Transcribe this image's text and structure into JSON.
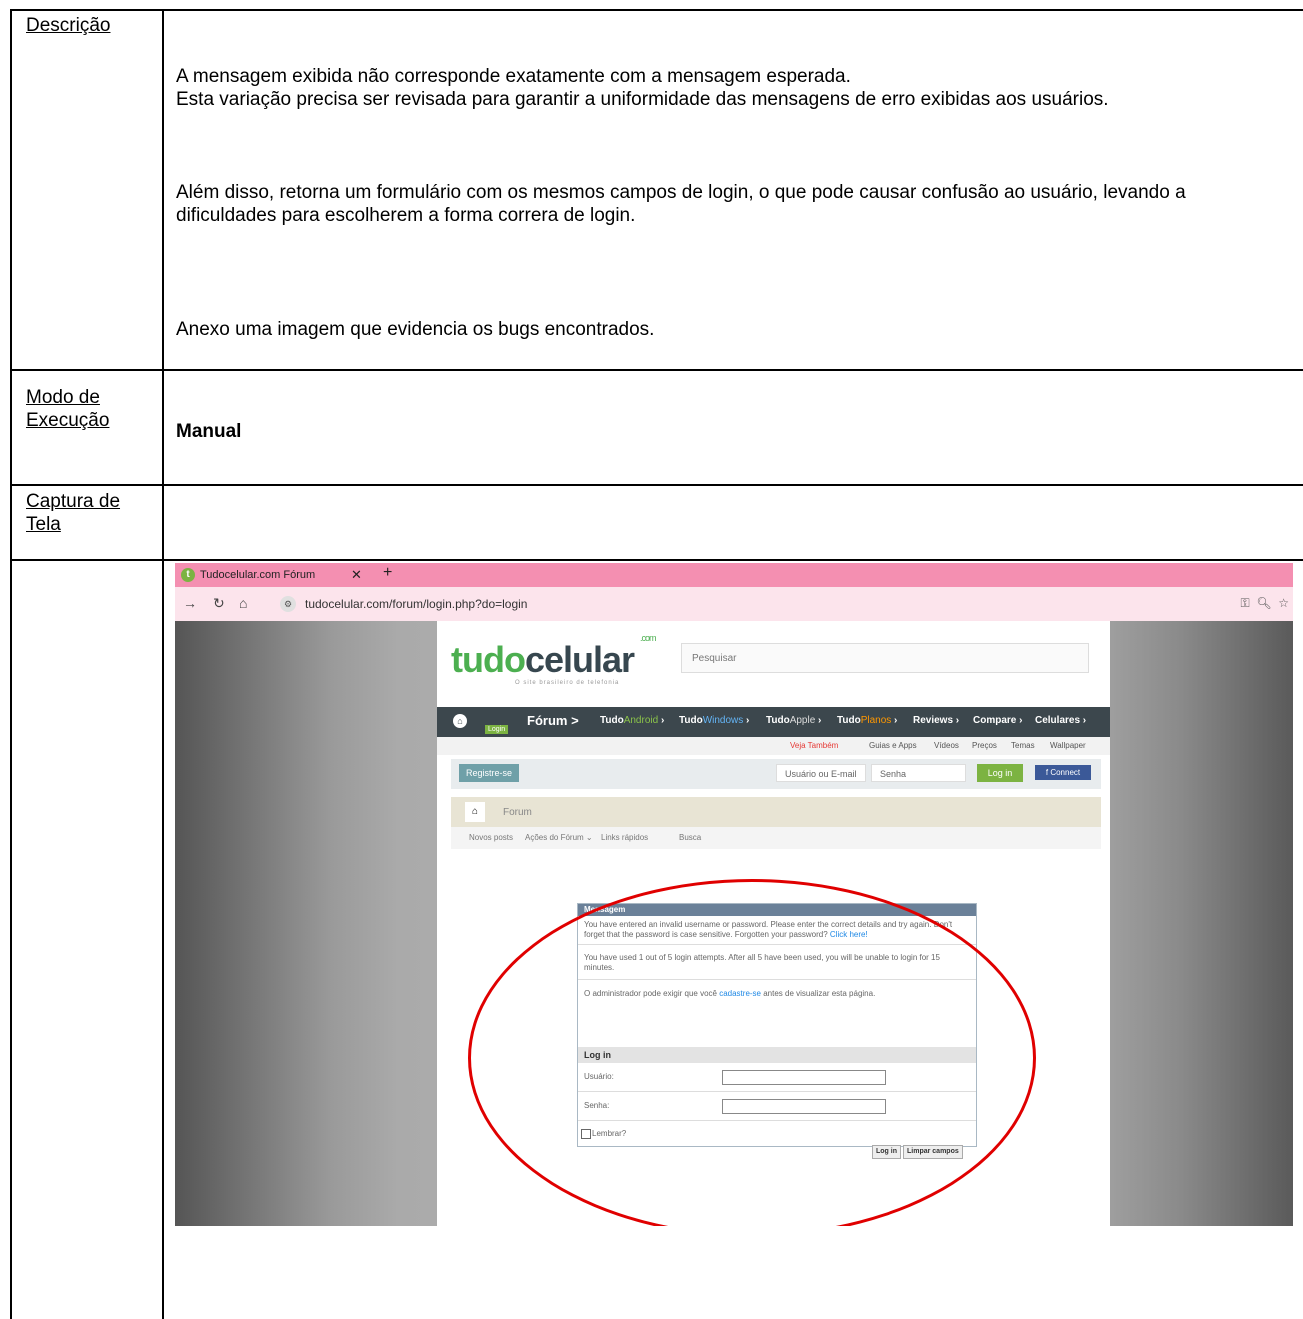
{
  "doc": {
    "rows": [
      {
        "label": "Descrição"
      },
      {
        "label_line1": "Modo de",
        "label_line2": "Execução",
        "value": "Manual"
      },
      {
        "label_line1": "Captura de",
        "label_line2": "Tela"
      }
    ],
    "description": [
      "A mensagem exibida não corresponde exatamente com a mensagem esperada.",
      "Esta variação precisa ser revisada para garantir a uniformidade das mensagens de erro exibidas aos usuários.",
      "Além disso, retorna um formulário com os mesmos campos de login, o que pode causar confusão ao usuário, levando a dificuldades para escolherem a forma correra de login.",
      "Anexo uma imagem que evidencia os bugs encontrados."
    ]
  },
  "browser": {
    "tab_title": "Tudocelular.com Fórum",
    "url": "tudocelular.com/forum/login.php?do=login",
    "favicon_icon": "tudocelular-favicon-icon",
    "accent_color": "#f48fb1"
  },
  "site": {
    "logo_main": "tudo",
    "logo_accent": "celular",
    "logo_suffix": ".com",
    "slogan": "O site brasileiro de telefonia",
    "search_placeholder": "Pesquisar",
    "login_badge": "Login",
    "forum_label": "Fórum",
    "menu": [
      {
        "prefix": "Tudo",
        "accent": "Android"
      },
      {
        "prefix": "Tudo",
        "accent": "Windows"
      },
      {
        "prefix": "Tudo",
        "accent": "Apple"
      },
      {
        "prefix": "Tudo",
        "accent": "Planos"
      },
      {
        "prefix": "Reviews",
        "accent": ""
      },
      {
        "prefix": "Compare",
        "accent": ""
      },
      {
        "prefix": "Celulares",
        "accent": ""
      }
    ],
    "subnav_veja": "Veja Também",
    "subnav": [
      "Guias e Apps",
      "Vídeos",
      "Preços",
      "Temas",
      "Wallpaper"
    ],
    "register": "Registre-se",
    "user_placeholder": "Usuário ou E-mail",
    "pass_placeholder": "Senha",
    "login_btn": "Log in",
    "connect_btn": "Connect",
    "breadcrumb": "Forum",
    "tools": [
      "Novos posts",
      "Ações do Fórum",
      "Links rápidos",
      "Busca"
    ],
    "message": {
      "header": "Mensagem",
      "p1": "You have entered an invalid username or password. Please enter the correct details and try again. Don't forget that the password is case sensitive. Forgotten your password?",
      "p1_link": "Click here!",
      "p2": "You have used 1 out of 5 login attempts. After all 5 have been used, you will be unable to login for 15 minutes.",
      "p3_before": "O administrador pode exigir que você",
      "p3_link": "cadastre-se",
      "p3_after": "antes de visualizar esta página.",
      "login_header": "Log in",
      "user_label": "Usuário:",
      "pass_label": "Senha:",
      "remember": "Lembrar?",
      "btn_login": "Log in",
      "btn_clear": "Limpar campos"
    },
    "annotation_color": "#e00000"
  }
}
